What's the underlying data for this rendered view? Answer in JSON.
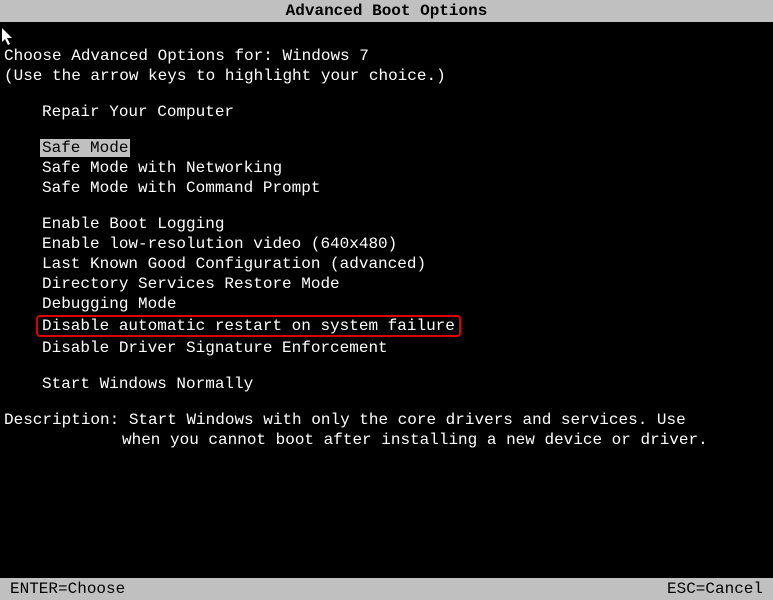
{
  "title": "Advanced Boot Options",
  "heading": "Choose Advanced Options for: Windows 7",
  "instruction": "(Use the arrow keys to highlight your choice.)",
  "menu": {
    "repair": "Repair Your Computer",
    "safe_mode": "Safe Mode",
    "safe_mode_net": "Safe Mode with Networking",
    "safe_mode_cmd": "Safe Mode with Command Prompt",
    "boot_logging": "Enable Boot Logging",
    "low_res": "Enable low-resolution video (640x480)",
    "last_known": "Last Known Good Configuration (advanced)",
    "ds_restore": "Directory Services Restore Mode",
    "debugging": "Debugging Mode",
    "disable_restart": "Disable automatic restart on system failure",
    "disable_sig": "Disable Driver Signature Enforcement",
    "start_normal": "Start Windows Normally"
  },
  "description": {
    "label": "Description:",
    "line1": "Start Windows with only the core drivers and services. Use",
    "line2": "when you cannot boot after installing a new device or driver."
  },
  "footer": {
    "enter": "ENTER=Choose",
    "esc": "ESC=Cancel"
  }
}
